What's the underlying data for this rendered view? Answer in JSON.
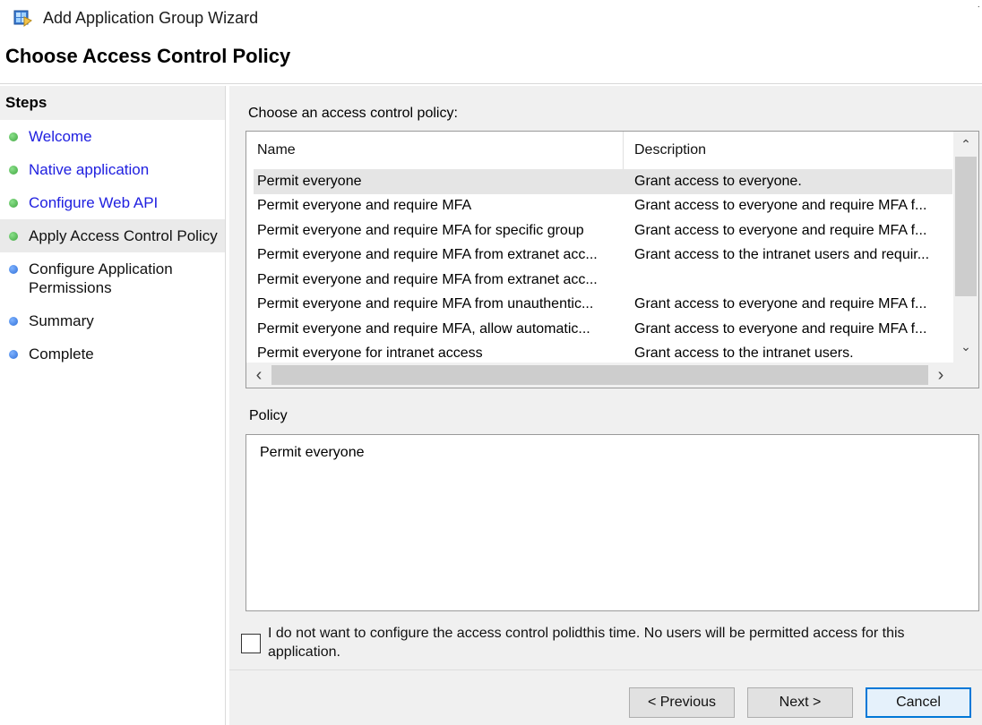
{
  "window": {
    "title": "Add Application Group Wizard",
    "corner_mark": "·"
  },
  "page_title": "Choose Access Control Policy",
  "steps": {
    "header": "Steps",
    "items": [
      {
        "label": "Welcome",
        "status": "completed",
        "color": "#3fa63f",
        "link": true
      },
      {
        "label": "Native application",
        "status": "completed",
        "color": "#3fa63f",
        "link": true
      },
      {
        "label": "Configure Web API",
        "status": "completed",
        "color": "#3fa63f",
        "link": true
      },
      {
        "label": "Apply Access Control Policy",
        "status": "current",
        "color": "#3fa63f",
        "link": false
      },
      {
        "label": "Configure Application Permissions",
        "status": "pending",
        "color": "#2f6fd8",
        "link": false
      },
      {
        "label": "Summary",
        "status": "pending",
        "color": "#2f6fd8",
        "link": false
      },
      {
        "label": "Complete",
        "status": "pending",
        "color": "#2f6fd8",
        "link": false
      }
    ]
  },
  "policy_list": {
    "label": "Choose an access control policy:",
    "columns": {
      "name": "Name",
      "description": "Description"
    },
    "rows": [
      {
        "name": "Permit everyone",
        "description": "Grant access to everyone.",
        "selected": true
      },
      {
        "name": "Permit everyone and require MFA",
        "description": "Grant access to everyone and require MFA f...",
        "selected": false
      },
      {
        "name": "Permit everyone and require MFA for specific group",
        "description": "Grant access to everyone and require MFA f...",
        "selected": false
      },
      {
        "name": "Permit everyone and require MFA from extranet acc...",
        "description": "Grant access to the intranet users and requir...",
        "selected": false
      },
      {
        "name": "Permit everyone and require MFA from extranet acc...",
        "description": "",
        "selected": false
      },
      {
        "name": "Permit everyone and require MFA from unauthentic...",
        "description": "Grant access to everyone and require MFA f...",
        "selected": false
      },
      {
        "name": "Permit everyone and require MFA, allow automatic...",
        "description": "Grant access to everyone and require MFA f...",
        "selected": false
      },
      {
        "name": "Permit everyone for intranet access",
        "description": "Grant access to the intranet users.",
        "selected": false
      }
    ],
    "scroll": {
      "up": "⌃",
      "down": "⌄",
      "left": "‹",
      "right": "›"
    }
  },
  "policy": {
    "label": "Policy",
    "text": "Permit everyone"
  },
  "opt_out": {
    "checked": false,
    "label": "I do not want to configure the access control polidthis time.  No users will be permitted access for this application."
  },
  "buttons": {
    "previous": "< Previous",
    "next": "Next >",
    "cancel": "Cancel"
  },
  "colors": {
    "link": "#2020e0",
    "completed_dot": "#3fa63f",
    "pending_dot": "#2f6fd8",
    "focus_border": "#0078d7"
  }
}
